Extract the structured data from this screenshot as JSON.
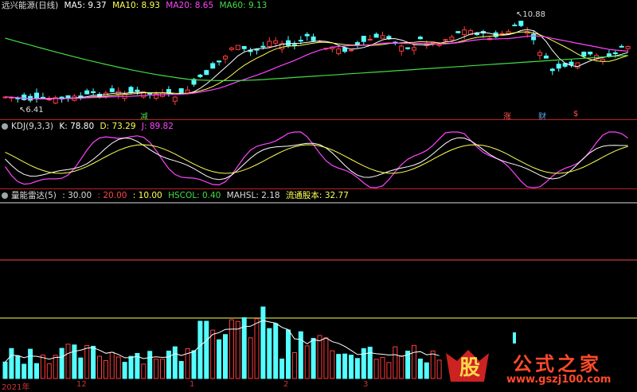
{
  "title": "远兴能源(日线)",
  "ma": [
    {
      "label": "MA5: 9.37",
      "color": "#ffffff"
    },
    {
      "label": "MA10: 8.93",
      "color": "#ffff55"
    },
    {
      "label": "MA20: 8.65",
      "color": "#ff44ff"
    },
    {
      "label": "MA60: 9.13",
      "color": "#44dd44"
    }
  ],
  "price_markers": {
    "high": "10.88",
    "low": "6.41"
  },
  "event_tags": [
    {
      "text": "减",
      "color": "#44dd44"
    },
    {
      "text": "涨",
      "color": "#ff5555"
    },
    {
      "text": "财",
      "color": "#55aaff"
    },
    {
      "text": "$",
      "color": "#ff5555"
    }
  ],
  "kdj": {
    "name": "KDJ(9,3,3)",
    "k": "K: 78.80",
    "d": "D: 73.29",
    "j": "J: 89.82",
    "colors": {
      "k": "#ffffff",
      "d": "#ffff55",
      "j": "#ff44ff"
    }
  },
  "vol": {
    "name": "量能雷达(5)",
    "v1": ": 30.00",
    "v2": ": 20.00",
    "v3": ": 10.00",
    "hscol": "HSCOL: 0.40",
    "mahsl": "MAHSL: 2.18",
    "float": "流通股本: 32.77",
    "colors": {
      "v1": "#dddddd",
      "v2": "#ff4444",
      "v3": "#ffff55",
      "hscol": "#44dd44",
      "mahsl": "#dddddd",
      "float": "#ffff55"
    }
  },
  "xaxis": [
    "2021年",
    "12",
    "1",
    "2",
    "3"
  ],
  "logo": {
    "glyph": "股",
    "text": "公式之家",
    "url": "www.gszj100.com"
  }
}
